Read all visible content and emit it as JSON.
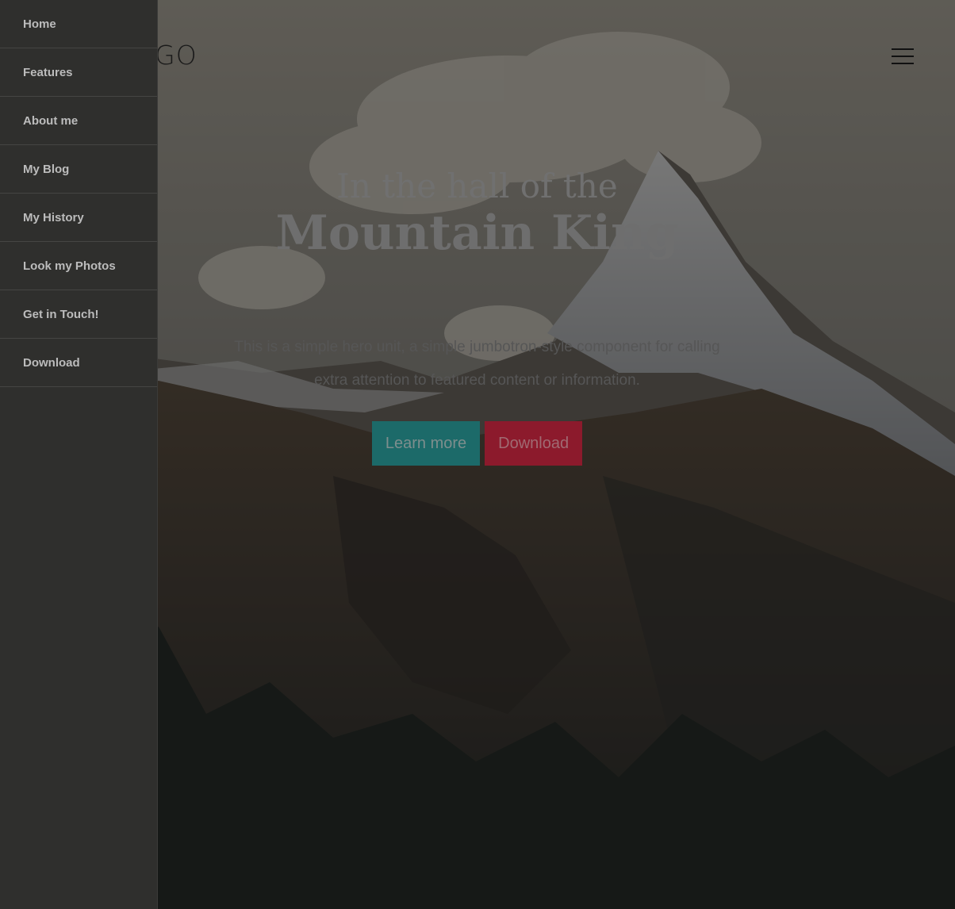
{
  "header": {
    "logo_text": "LOGO",
    "menu_icon": "hamburger-menu-icon"
  },
  "side_menu": {
    "items": [
      {
        "label": "Home"
      },
      {
        "label": "Features"
      },
      {
        "label": "About me"
      },
      {
        "label": "My Blog"
      },
      {
        "label": "My History"
      },
      {
        "label": "Look my Photos"
      },
      {
        "label": "Get in Touch!"
      },
      {
        "label": "Download"
      }
    ]
  },
  "hero": {
    "kicker": "In the hall of the",
    "title": "Mountain King",
    "description": "This is a simple hero unit, a simple jumbotron-style component for calling extra attention to featured content or information.",
    "learn_more_label": "Learn more",
    "download_label": "Download"
  },
  "colors": {
    "menu_background": "#2f2f2d",
    "learn_more_button": "#1c6a69",
    "download_button": "#8c1a2c"
  }
}
